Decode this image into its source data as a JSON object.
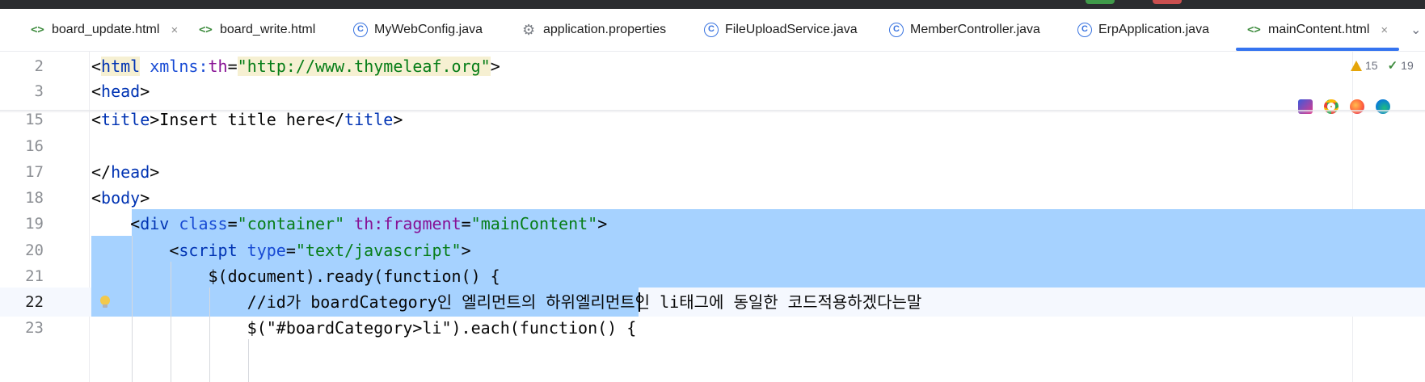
{
  "tabs": [
    {
      "label": "board_update.html",
      "icon": "html-file-icon",
      "closable": true,
      "active": false
    },
    {
      "label": "board_write.html",
      "icon": "html-file-icon",
      "closable": false,
      "active": false
    },
    {
      "label": "MyWebConfig.java",
      "icon": "java-class-icon",
      "closable": false,
      "active": false
    },
    {
      "label": "application.properties",
      "icon": "gear-icon",
      "closable": false,
      "active": false
    },
    {
      "label": "FileUploadService.java",
      "icon": "java-class-icon",
      "closable": false,
      "active": false
    },
    {
      "label": "MemberController.java",
      "icon": "java-class-icon",
      "closable": false,
      "active": false
    },
    {
      "label": "ErpApplication.java",
      "icon": "spring-boot-class-icon",
      "closable": false,
      "active": false
    },
    {
      "label": "mainContent.html",
      "icon": "html-file-icon",
      "closable": true,
      "active": true
    }
  ],
  "tab_close_glyph": "×",
  "tab_html_glyph": "<>",
  "tab_class_glyph": "C",
  "tab_gear_glyph": "⚙",
  "tabs_menu_glyph": "⌄",
  "inspections": {
    "warnings": "15",
    "ok": "19",
    "ok_glyph": "✓"
  },
  "browser_icons": [
    "intellij-preview-icon",
    "chrome-icon",
    "firefox-icon",
    "edge-icon"
  ],
  "colors": {
    "accent": "#3574f0",
    "selection": "#a6d2ff",
    "tag": "#0033b3",
    "string": "#067d17",
    "namespace": "#871094"
  },
  "lines": [
    {
      "num": "2",
      "parts": [
        {
          "t": "<",
          "c": "plain"
        },
        {
          "t": "html",
          "c": "tag"
        },
        {
          "t": " ",
          "c": "plain"
        },
        {
          "t": "xmlns:",
          "c": "attr"
        },
        {
          "t": "th",
          "c": "ns"
        },
        {
          "t": "=",
          "c": "plain"
        },
        {
          "t": "\"http://www.thymeleaf.org\"",
          "c": "str"
        },
        {
          "t": ">",
          "c": "plain"
        }
      ]
    },
    {
      "num": "3",
      "parts": [
        {
          "t": "<",
          "c": "plain"
        },
        {
          "t": "head",
          "c": "tag"
        },
        {
          "t": ">",
          "c": "plain"
        }
      ]
    },
    {
      "num": "15",
      "parts": [
        {
          "t": "<",
          "c": "plain"
        },
        {
          "t": "title",
          "c": "tag"
        },
        {
          "t": ">Insert title here</",
          "c": "plain"
        },
        {
          "t": "title",
          "c": "tag"
        },
        {
          "t": ">",
          "c": "plain"
        }
      ]
    },
    {
      "num": "16",
      "parts": []
    },
    {
      "num": "17",
      "parts": [
        {
          "t": "</",
          "c": "plain"
        },
        {
          "t": "head",
          "c": "tag"
        },
        {
          "t": ">",
          "c": "plain"
        }
      ]
    },
    {
      "num": "18",
      "parts": [
        {
          "t": "<",
          "c": "plain"
        },
        {
          "t": "body",
          "c": "tag"
        },
        {
          "t": ">",
          "c": "plain"
        }
      ]
    },
    {
      "num": "19",
      "parts": [
        {
          "t": "    <",
          "c": "plain"
        },
        {
          "t": "div",
          "c": "tag"
        },
        {
          "t": " ",
          "c": "plain"
        },
        {
          "t": "class",
          "c": "attr"
        },
        {
          "t": "=",
          "c": "plain"
        },
        {
          "t": "\"container\"",
          "c": "str"
        },
        {
          "t": " ",
          "c": "plain"
        },
        {
          "t": "th:",
          "c": "ns"
        },
        {
          "t": "fragment",
          "c": "ns"
        },
        {
          "t": "=",
          "c": "plain"
        },
        {
          "t": "\"mainContent\"",
          "c": "str"
        },
        {
          "t": ">",
          "c": "plain"
        }
      ]
    },
    {
      "num": "20",
      "parts": [
        {
          "t": "        <",
          "c": "plain"
        },
        {
          "t": "script",
          "c": "tag"
        },
        {
          "t": " ",
          "c": "plain"
        },
        {
          "t": "type",
          "c": "attr"
        },
        {
          "t": "=",
          "c": "plain"
        },
        {
          "t": "\"text/javascript\"",
          "c": "str"
        },
        {
          "t": ">",
          "c": "plain"
        }
      ]
    },
    {
      "num": "21",
      "parts": [
        {
          "t": "            $(document).ready(function() {",
          "c": "plain"
        }
      ]
    },
    {
      "num": "22",
      "parts": [
        {
          "t": "                //id가 boardCategory인 엘리먼트의 하위엘리먼트인 li태그에 동일한 코드적용하겠다는말",
          "c": "plain"
        }
      ]
    },
    {
      "num": "23",
      "parts": [
        {
          "t": "                $(\"#boardCategory>li\").each(function() {",
          "c": "plain"
        }
      ]
    }
  ]
}
